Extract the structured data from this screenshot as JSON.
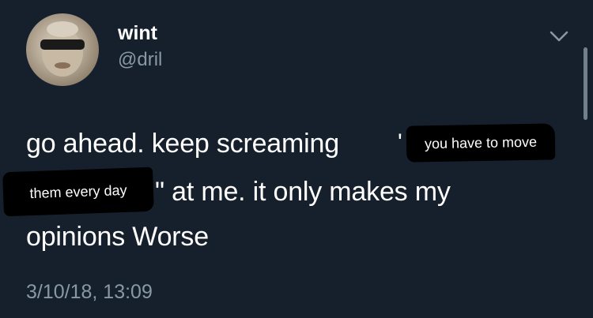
{
  "author": {
    "name": "wint",
    "handle": "@dril"
  },
  "tweet": {
    "line1": "go ahead. keep screaming",
    "quote_open": "'",
    "redacted_text_1": "you have to move",
    "redacted_text_2": "them every day",
    "line2_rest": "\" at me. it only makes my",
    "line3": "opinions Worse"
  },
  "timestamp": "3/10/18, 13:09",
  "icons": {
    "menu": "chevron-down-icon",
    "avatar": "profile-photo"
  },
  "colors": {
    "background": "#16202c",
    "primary_text": "#ffffff",
    "secondary_text": "#8899a6",
    "redaction": "#000000"
  }
}
